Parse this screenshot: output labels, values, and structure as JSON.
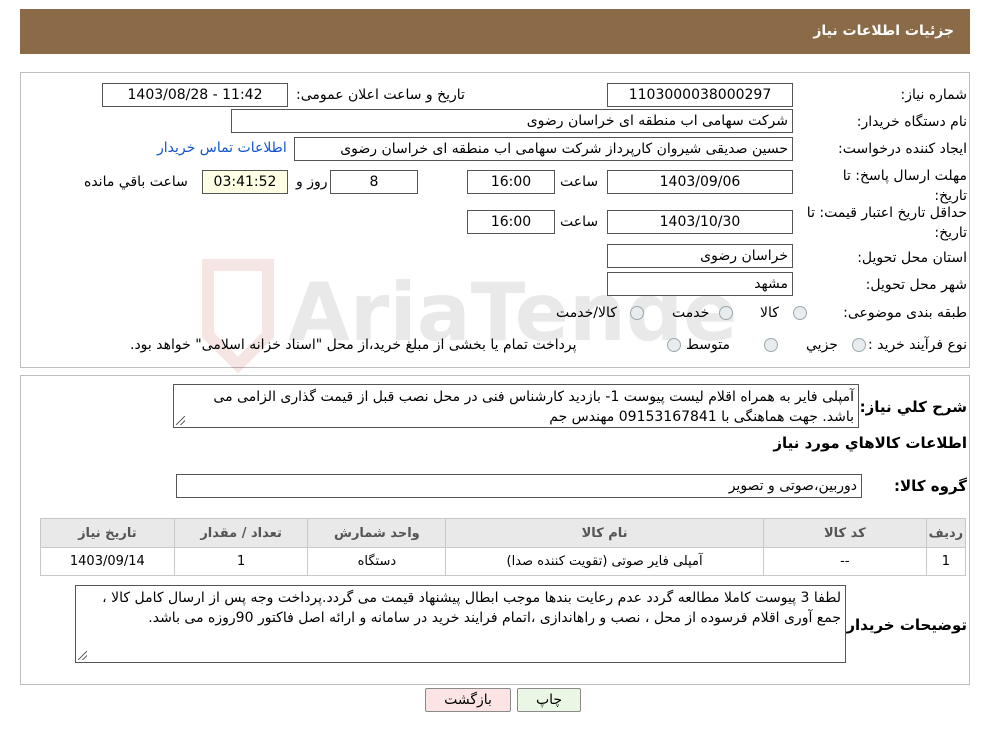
{
  "header": {
    "title": "جزئیات اطلاعات نیاز"
  },
  "form": {
    "need_number_label": "شماره نیاز:",
    "need_number": "1103000038000297",
    "announce_label": "تاریخ و ساعت اعلان عمومی:",
    "announce_value": "1403/08/28 - 11:42",
    "buyer_org_label": "نام دستگاه خریدار:",
    "buyer_org": "شرکت سهامی اب منطقه ای خراسان رضوی",
    "requester_label": "ایجاد کننده درخواست:",
    "requester": "حسین صدیقی شیروان کارپرداز شرکت سهامی اب منطقه ای خراسان رضوی",
    "contact_link": "اطلاعات تماس خریدار",
    "deadline_label": "مهلت ارسال پاسخ: تا تاریخ:",
    "deadline_date": "1403/09/06",
    "time_label": "ساعت",
    "deadline_time": "16:00",
    "days_value": "8",
    "days_label": "روز و",
    "remaining_time": "03:41:52",
    "remaining_label": "ساعت باقي مانده",
    "validity_label": "حداقل تاریخ اعتبار قیمت: تا تاریخ:",
    "validity_date": "1403/10/30",
    "validity_time": "16:00",
    "province_label": "استان محل تحویل:",
    "province": "خراسان رضوی",
    "city_label": "شهر محل تحویل:",
    "city": "مشهد",
    "category_label": "طبقه بندی موضوعی:",
    "category_options": [
      "کالا",
      "خدمت",
      "کالا/خدمت"
    ],
    "purchase_type_label": "نوع فرآیند خرید :",
    "purchase_options": [
      "جزیي",
      "متوسط"
    ],
    "purchase_note": "پرداخت تمام یا بخشی از مبلغ خرید،از محل \"اسناد خزانه اسلامی\" خواهد بود."
  },
  "need": {
    "summary_label": "شرح کلي نياز:",
    "summary": "آمپلی فایر به همراه اقلام لیست پیوست 1- بازدید کارشناس فنی در محل نصب قبل از قیمت گذاری الزامی می باشد. جهت هماهنگی با 09153167841 مهندس جم",
    "goods_info_title": "اطلاعات کالاهاي مورد نياز",
    "goods_group_label": "گروه کالا:",
    "goods_group": "دوربین،صوتی و تصویر"
  },
  "table": {
    "headers": [
      "رديف",
      "کد کالا",
      "نام کالا",
      "واحد شمارش",
      "تعداد / مقدار",
      "تاریخ نیاز"
    ],
    "rows": [
      [
        "1",
        "--",
        "آمپلی فایر صوتی (تقویت کننده صدا)",
        "دستگاه",
        "1",
        "1403/09/14"
      ]
    ]
  },
  "notes": {
    "label": "توضیحات خریدار:",
    "text": "لطفا 3 پیوست کاملا مطالعه گردد عدم رعایت بندها موجب ابطال پیشنهاد قیمت می گردد.پرداخت وجه پس از ارسال کامل کالا ، جمع آوری اقلام فرسوده از محل ، نصب و راهاندازی ،اتمام فرایند خرید در سامانه و ارائه اصل فاکتور 90روزه می باشد."
  },
  "buttons": {
    "print": "چاپ",
    "back": "بازگشت"
  },
  "watermark": {
    "text": "AriaTender.neT"
  },
  "colors": {
    "header": "#8B6B47",
    "link": "#1155cc",
    "back_button": "#fde4e4",
    "print_button": "#eaf7e4"
  }
}
